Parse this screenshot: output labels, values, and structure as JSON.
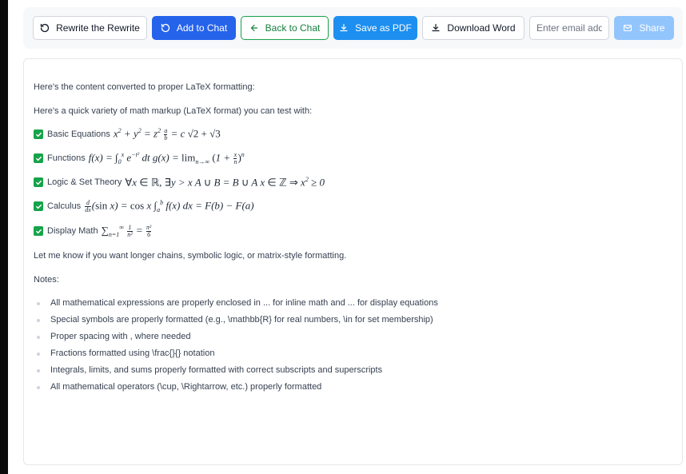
{
  "toolbar": {
    "rewrite_label": "Rewrite the Rewrite",
    "add_to_chat_label": "Add to Chat",
    "back_to_chat_label": "Back to Chat",
    "save_pdf_label": "Save as PDF",
    "download_word_label": "Download Word",
    "email_placeholder": "Enter email address",
    "share_label": "Share"
  },
  "content": {
    "intro1": "Here's the content converted to proper LaTeX formatting:",
    "intro2": "Here's a quick variety of math markup (LaTeX format) you can test with:",
    "items": [
      {
        "label": "Basic Equations"
      },
      {
        "label": "Functions"
      },
      {
        "label": "Logic & Set Theory"
      },
      {
        "label": "Calculus"
      },
      {
        "label": "Display Math"
      }
    ],
    "outro": "Let me know if you want longer chains, symbolic logic, or matrix-style formatting.",
    "notes_heading": "Notes:",
    "notes": [
      "All mathematical expressions are properly enclosed in ... for inline math and ... for display equations",
      "Special symbols are properly formatted (e.g., \\mathbb{R} for real numbers, \\in for set membership)",
      "Proper spacing with , where needed",
      "Fractions formatted using \\frac{}{} notation",
      "Integrals, limits, and sums properly formatted with correct subscripts and superscripts",
      "All mathematical operators (\\cup, \\Rightarrow, etc.) properly formatted"
    ]
  }
}
